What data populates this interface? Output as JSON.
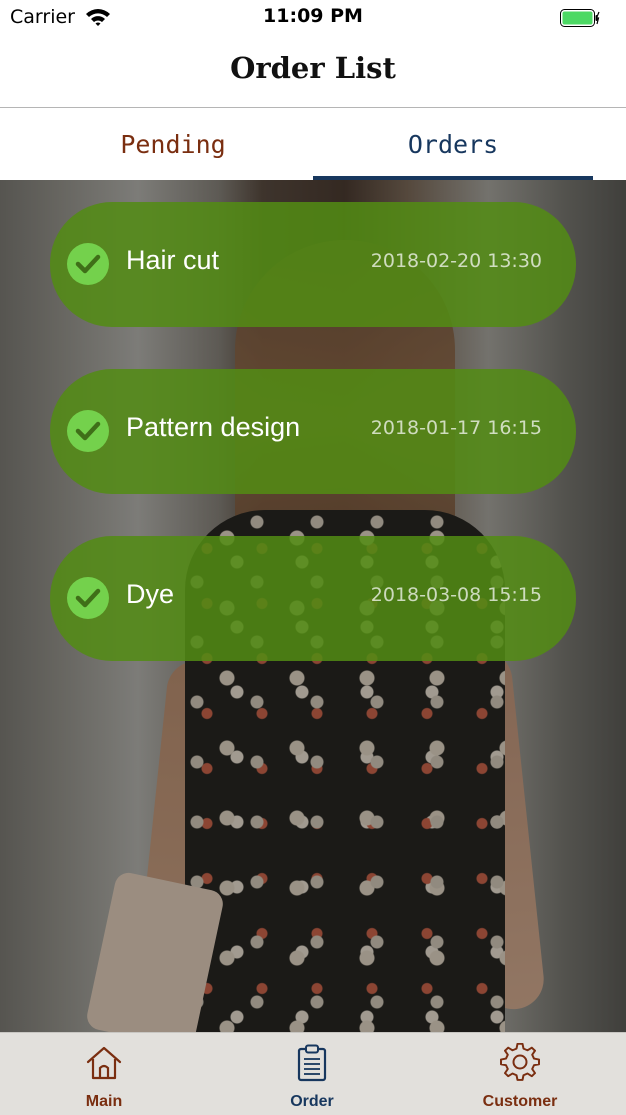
{
  "status_bar": {
    "carrier": "Carrier",
    "time": "11:09 PM"
  },
  "nav": {
    "title": "Order List"
  },
  "tabs": [
    {
      "label": "Pending",
      "selected": false
    },
    {
      "label": "Orders",
      "selected": true
    }
  ],
  "orders": [
    {
      "name": "Hair cut",
      "date": "2018-02-20 13:30",
      "icon": "check-circle-icon"
    },
    {
      "name": "Pattern design",
      "date": "2018-01-17 16:15",
      "icon": "check-circle-icon"
    },
    {
      "name": "Dye",
      "date": "2018-03-08 15:15",
      "icon": "check-circle-icon"
    }
  ],
  "tab_bar": [
    {
      "label": "Main",
      "icon": "home-icon",
      "color": "#7a2e10"
    },
    {
      "label": "Order",
      "icon": "clipboard-icon",
      "color": "#17375e",
      "selected": true
    },
    {
      "label": "Customer",
      "icon": "gear-icon",
      "color": "#7a2e10"
    }
  ],
  "colors": {
    "accent": "#17375e",
    "brand_brown": "#7a2e10",
    "order_green": "#538c14",
    "check_green": "#74d14c",
    "battery_green": "#4cd964"
  }
}
